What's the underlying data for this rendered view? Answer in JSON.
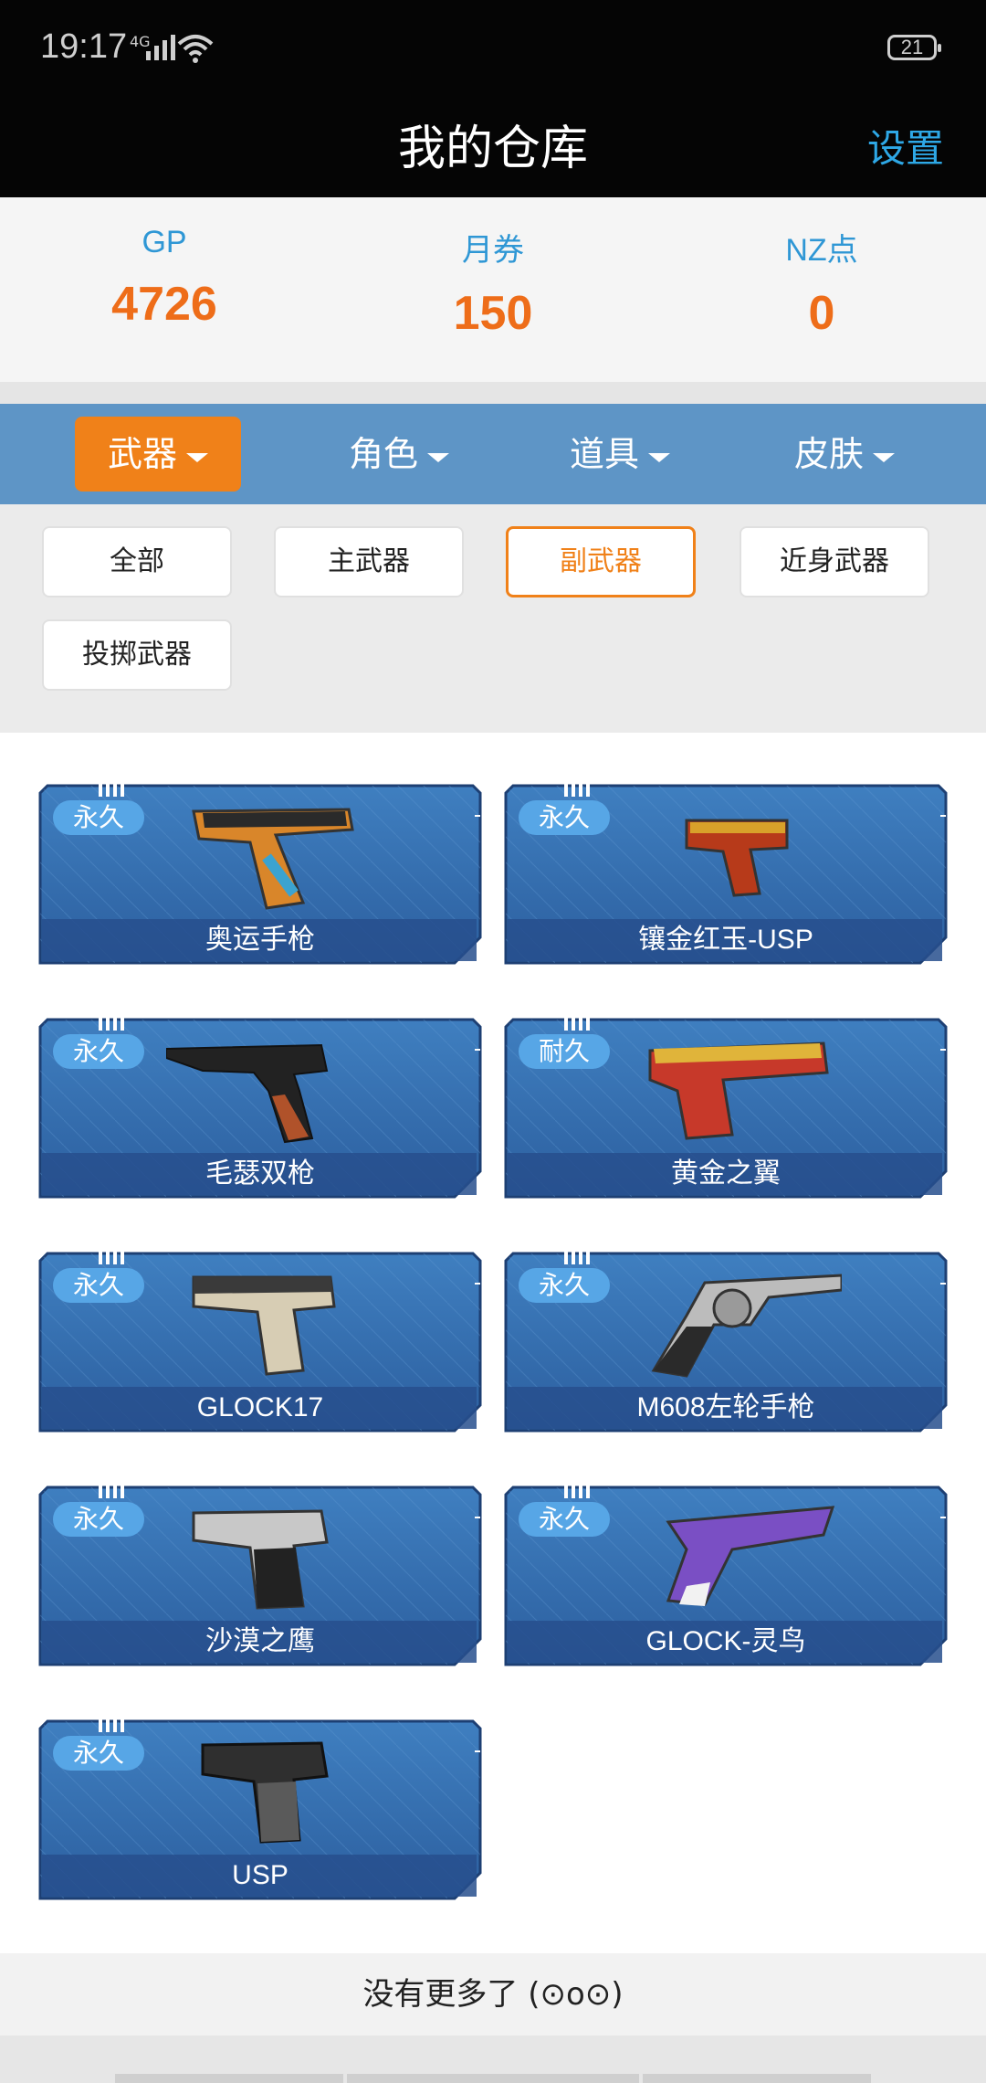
{
  "status_bar": {
    "time": "19:17",
    "network": "4G",
    "battery": "21"
  },
  "header": {
    "title": "我的仓库",
    "settings_label": "设置"
  },
  "currencies": [
    {
      "label": "GP",
      "value": "4726"
    },
    {
      "label": "月券",
      "value": "150"
    },
    {
      "label": "NZ点",
      "value": "0"
    }
  ],
  "categories": [
    "武器",
    "角色",
    "道具",
    "皮肤"
  ],
  "subcategories": [
    "全部",
    "主武器",
    "副武器",
    "近身武器",
    "投掷武器"
  ],
  "items": [
    {
      "tag": "永久",
      "name": "奥运手枪"
    },
    {
      "tag": "永久",
      "name": "镶金红玉-USP"
    },
    {
      "tag": "永久",
      "name": "毛瑟双枪"
    },
    {
      "tag": "耐久",
      "name": "黄金之翼"
    },
    {
      "tag": "永久",
      "name": "GLOCK17"
    },
    {
      "tag": "永久",
      "name": "M608左轮手枪"
    },
    {
      "tag": "永久",
      "name": "沙漠之鹰"
    },
    {
      "tag": "永久",
      "name": "GLOCK-灵鸟"
    },
    {
      "tag": "永久",
      "name": "USP"
    }
  ],
  "footer": {
    "text": "没有更多了 (⊙o⊙)"
  }
}
